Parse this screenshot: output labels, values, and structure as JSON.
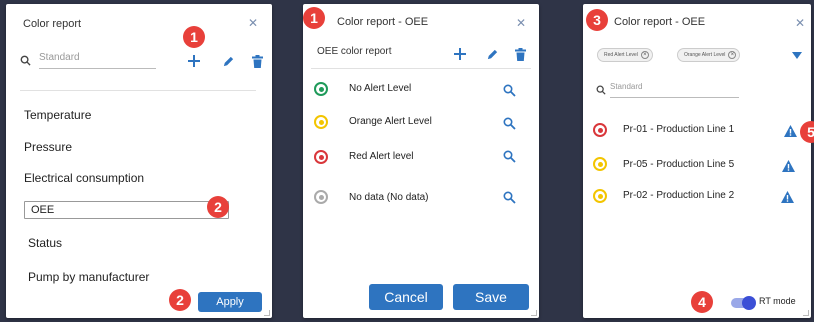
{
  "colors": {
    "accent": "#2e74c0",
    "badge": "#e8403a",
    "green": "#1f9a5a",
    "yellow": "#f3c500",
    "red": "#d9373b",
    "grey": "#aaaaaa"
  },
  "panel1": {
    "title": "Color report",
    "search_placeholder": "Standard",
    "items": [
      "Temperature",
      "Pressure",
      "Electrical consumption"
    ],
    "edit_value": "OEE",
    "items_after": [
      "Status",
      "Pump by manufacturer"
    ],
    "apply_label": "Apply",
    "badges": [
      "1",
      "2",
      "2"
    ]
  },
  "panel2": {
    "title": "Color report - OEE",
    "subtitle": "OEE color report",
    "levels": [
      {
        "label": "No Alert Level",
        "color": "green"
      },
      {
        "label": "Orange Alert Level",
        "color": "yellow"
      },
      {
        "label": "Red Alert level",
        "color": "red"
      },
      {
        "label": "No data (No data)",
        "color": "grey"
      }
    ],
    "cancel_label": "Cancel",
    "save_label": "Save",
    "badge": "1"
  },
  "panel3": {
    "title": "Color report - OEE",
    "chips": [
      "Red Alert Level",
      "Orange Alert Level"
    ],
    "search_placeholder": "Standard",
    "lines": [
      {
        "label": "Pr-01 - Production Line 1",
        "color": "red"
      },
      {
        "label": "Pr-05 - Production Line 5",
        "color": "yellow"
      },
      {
        "label": "Pr-02 - Production Line 2",
        "color": "yellow"
      }
    ],
    "rt_label": "RT mode",
    "badges": [
      "3",
      "5",
      "4"
    ]
  }
}
